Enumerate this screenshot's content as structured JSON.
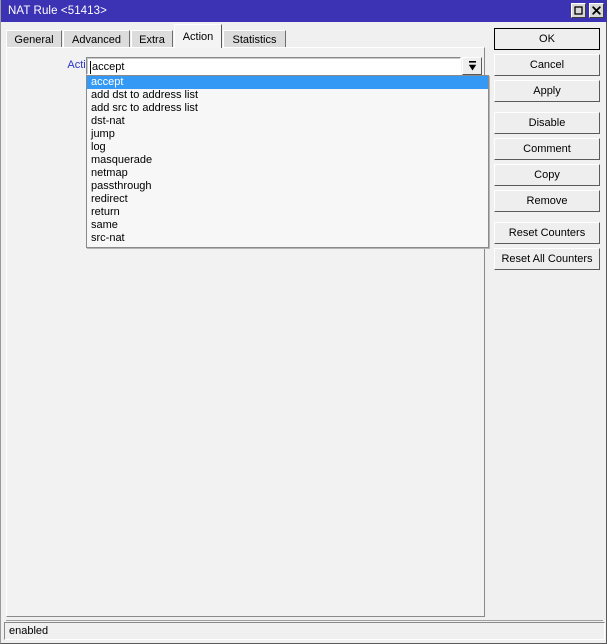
{
  "window": {
    "title": "NAT Rule <51413>",
    "titlebar_color": "#3b32b4",
    "controls": [
      {
        "name": "maximize-button",
        "icon": "maximize-icon"
      },
      {
        "name": "close-button",
        "icon": "close-icon"
      }
    ]
  },
  "tabs": [
    {
      "label": "General",
      "active": false
    },
    {
      "label": "Advanced",
      "active": false
    },
    {
      "label": "Extra",
      "active": false
    },
    {
      "label": "Action",
      "active": true
    },
    {
      "label": "Statistics",
      "active": false
    }
  ],
  "form": {
    "action_label": "Action:",
    "action_label_color": "#2a35cc",
    "action_value": "accept",
    "dropdown_icon": "chevron-down-bar-icon"
  },
  "dropdown": {
    "highlight_color": "#3399f5",
    "selected": "accept",
    "options": [
      "accept",
      "add dst to address list",
      "add src to address list",
      "dst-nat",
      "jump",
      "log",
      "masquerade",
      "netmap",
      "passthrough",
      "redirect",
      "return",
      "same",
      "src-nat"
    ]
  },
  "buttons": [
    {
      "label": "OK",
      "focused": true,
      "gap": false
    },
    {
      "label": "Cancel",
      "focused": false,
      "gap": false
    },
    {
      "label": "Apply",
      "focused": false,
      "gap": false
    },
    {
      "label": "Disable",
      "focused": false,
      "gap": true
    },
    {
      "label": "Comment",
      "focused": false,
      "gap": false
    },
    {
      "label": "Copy",
      "focused": false,
      "gap": false
    },
    {
      "label": "Remove",
      "focused": false,
      "gap": false
    },
    {
      "label": "Reset Counters",
      "focused": false,
      "gap": true
    },
    {
      "label": "Reset All Counters",
      "focused": false,
      "gap": false
    }
  ],
  "statusbar": {
    "text": "enabled"
  }
}
